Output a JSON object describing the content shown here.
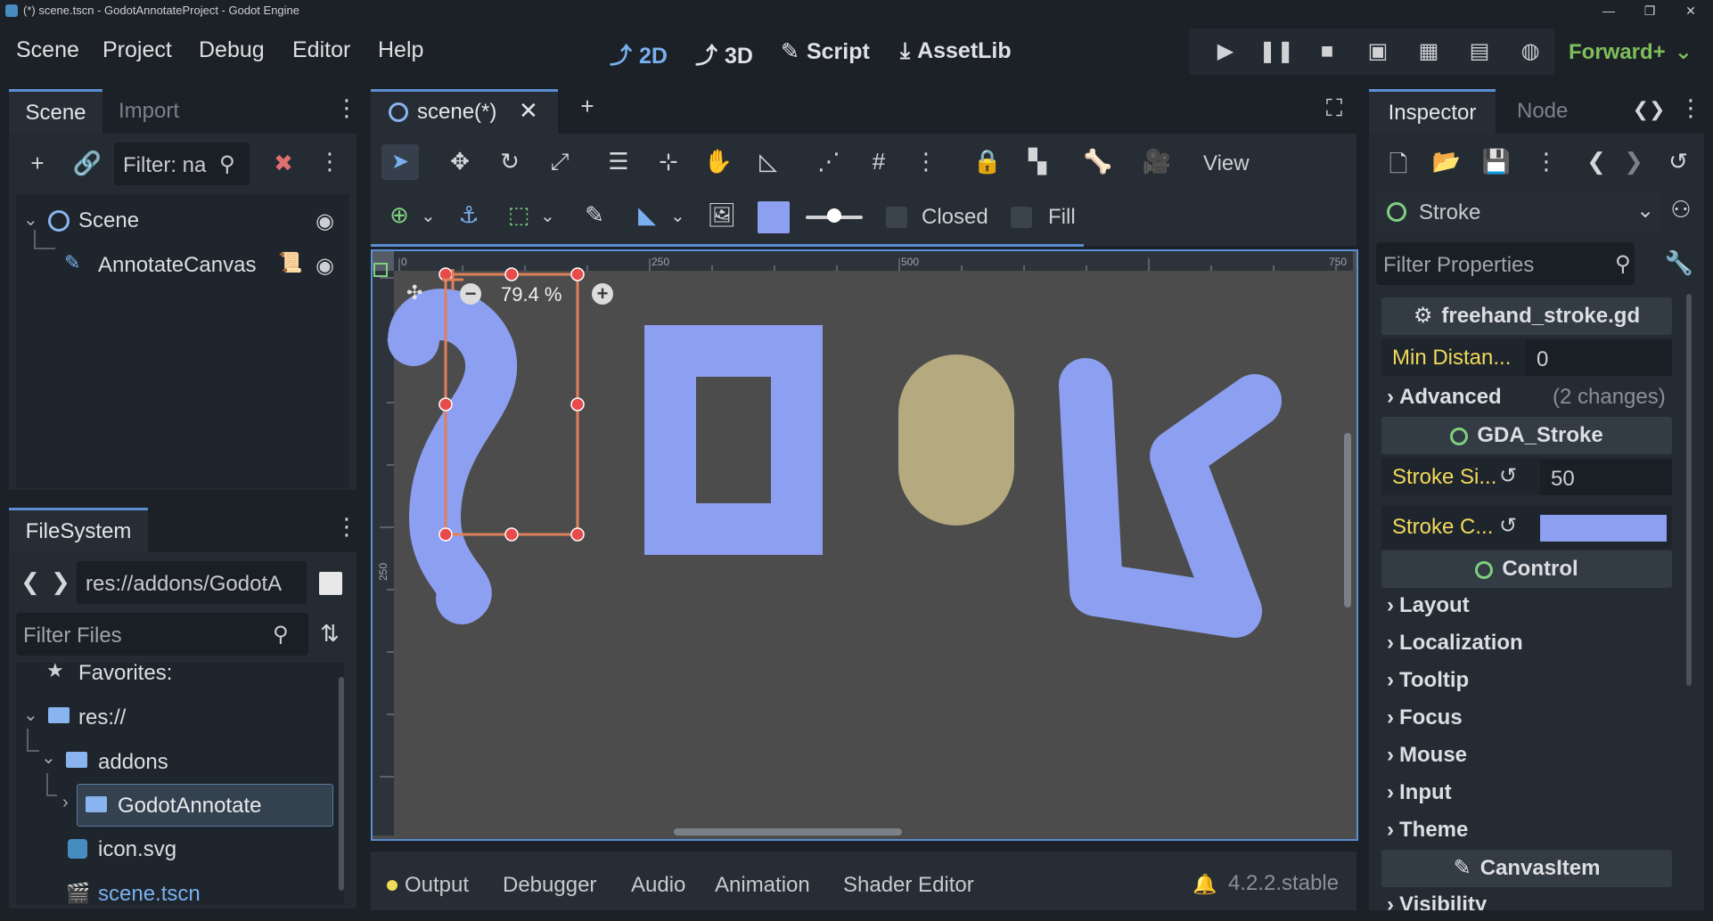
{
  "window": {
    "title": "(*) scene.tscn - GodotAnnotateProject - Godot Engine"
  },
  "menu": [
    "Scene",
    "Project",
    "Debug",
    "Editor",
    "Help"
  ],
  "modes": [
    {
      "label": "2D",
      "icon": "2d-icon",
      "active": true
    },
    {
      "label": "3D",
      "icon": "3d-icon",
      "active": false
    },
    {
      "label": "Script",
      "icon": "script-icon",
      "active": false
    },
    {
      "label": "AssetLib",
      "icon": "assetlib-icon",
      "active": false
    }
  ],
  "renderer": "Forward+",
  "scene_dock": {
    "tabs": [
      "Scene",
      "Import"
    ],
    "filter_placeholder": "Filter: na",
    "tree": [
      {
        "label": "Scene",
        "icon": "node-circle-icon",
        "level": 0
      },
      {
        "label": "AnnotateCanvas",
        "icon": "annotate-node-icon",
        "level": 1
      }
    ]
  },
  "filesystem_dock": {
    "tab": "FileSystem",
    "path": "res://addons/GodotA",
    "filter_placeholder": "Filter Files",
    "items": [
      {
        "label": "Favorites:",
        "icon": "star-icon"
      },
      {
        "label": "res://",
        "icon": "folder-icon"
      },
      {
        "label": "addons",
        "icon": "folder-icon"
      },
      {
        "label": "GodotAnnotate",
        "icon": "folder-icon",
        "selected": true
      },
      {
        "label": "icon.svg",
        "icon": "godot-icon"
      },
      {
        "label": "scene.tscn",
        "icon": "clapper-icon"
      }
    ]
  },
  "editor": {
    "tab": "scene(*)",
    "view_label": "View",
    "closed_label": "Closed",
    "fill_label": "Fill",
    "zoom": "79.4 %",
    "swatch_color": "#8d9ff0",
    "ruler_top": [
      "0",
      "250",
      "500",
      "750"
    ],
    "ruler_left": [
      "250"
    ]
  },
  "bottom_panel": {
    "tabs": [
      "Output",
      "Debugger",
      "Audio",
      "Animation",
      "Shader Editor"
    ],
    "version": "4.2.2.stable"
  },
  "inspector": {
    "tabs": [
      "Inspector",
      "Node"
    ],
    "object": "Stroke",
    "filter_placeholder": "Filter Properties",
    "script_header": "freehand_stroke.gd",
    "min_distance_label": "Min Distan...",
    "min_distance_value": "0",
    "advanced_label": "Advanced",
    "advanced_changes": "(2 changes)",
    "gda_stroke_header": "GDA_Stroke",
    "stroke_size_label": "Stroke Si...",
    "stroke_size_value": "50",
    "stroke_color_label": "Stroke C...",
    "stroke_color": "#8d9ff0",
    "control_header": "Control",
    "groups": [
      "Layout",
      "Localization",
      "Tooltip",
      "Focus",
      "Mouse",
      "Input",
      "Theme"
    ],
    "canvas_item_header": "CanvasItem",
    "visibility_label": "Visibility"
  },
  "colors": {
    "accent": "#5a8fd1",
    "stroke_blue": "#8d9ff0",
    "stroke_tan": "#b4a97f",
    "canvas_bg": "#4c4c4c",
    "selection": "#e0805a",
    "handle": "#e84b4b"
  }
}
